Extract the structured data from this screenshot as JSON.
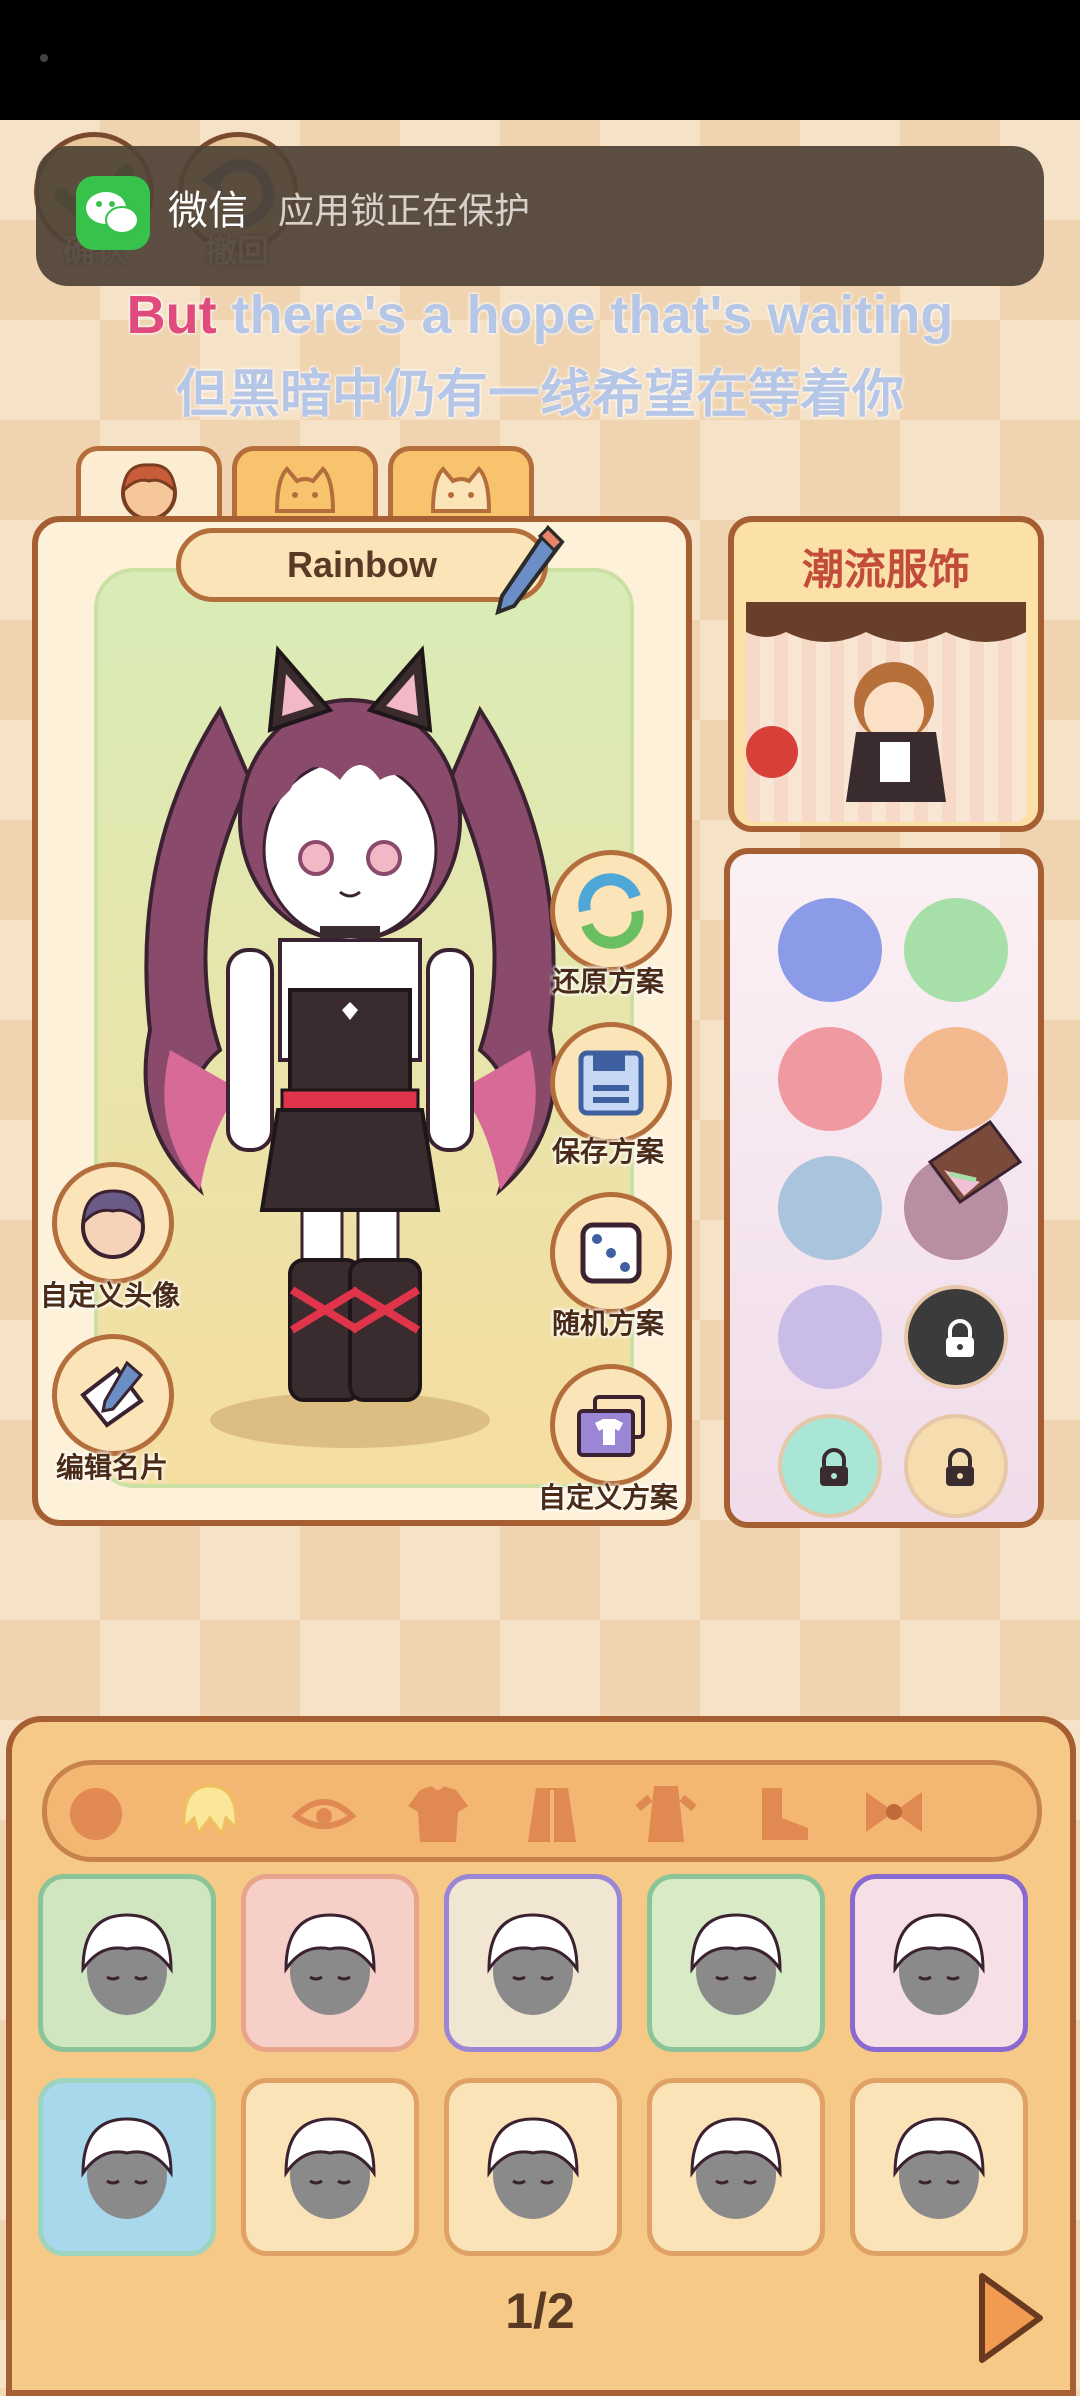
{
  "top_buttons": {
    "confirm": "确认",
    "undo": "撤回"
  },
  "notification": {
    "app": "微信",
    "message": "应用锁正在保护"
  },
  "lyrics": {
    "en_highlight": "But",
    "en_rest": " there's a hope that's waiting",
    "cn": "但黑暗中仍有一线希望在等着你"
  },
  "character": {
    "name": "Rainbow"
  },
  "tabs": [
    {
      "icon": "human-face-icon"
    },
    {
      "icon": "cat-face-icon"
    },
    {
      "icon": "cat-face-icon"
    }
  ],
  "actions": {
    "restore": "还原方案",
    "save": "保存方案",
    "random": "随机方案",
    "custom": "自定义方案",
    "avatar": "自定义头像",
    "edit_card": "编辑名片"
  },
  "fashion": {
    "title": "潮流服饰"
  },
  "colors": [
    {
      "hex": "#8c9be8",
      "locked": false
    },
    {
      "hex": "#a6e0a8",
      "locked": false
    },
    {
      "hex": "#ee9aa0",
      "locked": false
    },
    {
      "hex": "#f3b98f",
      "locked": false
    },
    {
      "hex": "#a9c4dc",
      "locked": false
    },
    {
      "hex": "#b88ea3",
      "locked": false
    },
    {
      "hex": "#c9bde8",
      "locked": false
    },
    {
      "hex": "#3b3b3b",
      "locked": true
    },
    {
      "hex": "#a9e6d5",
      "locked": true
    },
    {
      "hex": "#f5ddb0",
      "locked": true
    }
  ],
  "categories": [
    "face-icon",
    "hair-icon",
    "eye-icon",
    "top-icon",
    "coat-icon",
    "dress-icon",
    "shoe-icon",
    "bow-icon"
  ],
  "pager": {
    "text": "1/2"
  }
}
